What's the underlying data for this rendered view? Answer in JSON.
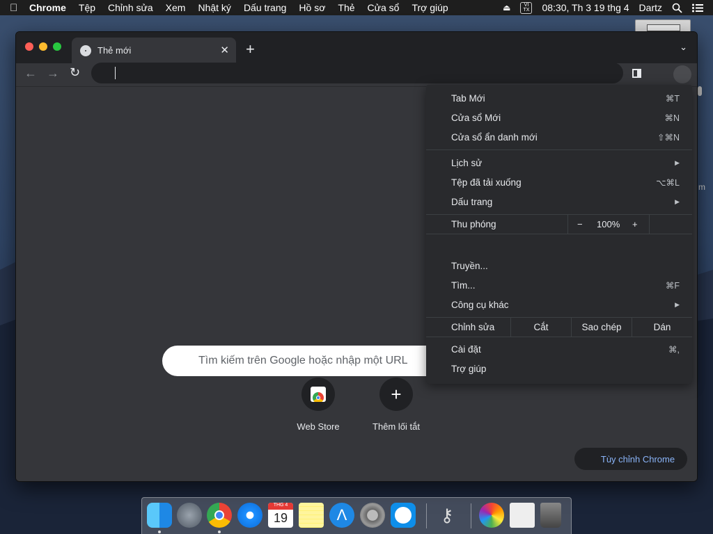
{
  "menubar": {
    "app": "Chrome",
    "items": [
      "Tệp",
      "Chỉnh sửa",
      "Xem",
      "Nhật ký",
      "Dấu trang",
      "Hồ sơ",
      "Thẻ",
      "Cửa sổ",
      "Trợ giúp"
    ],
    "vi_top": "VI",
    "vi_bottom": "TX",
    "clock": "08:30, Th 3 19 thg 4",
    "user": "Dartz"
  },
  "tab": {
    "title": "Thẻ mới"
  },
  "newtab": {
    "search_placeholder": "Tìm kiếm trên Google hoặc nhập một URL",
    "shortcuts": [
      {
        "label": "Web Store"
      },
      {
        "label": "Thêm lối tắt"
      }
    ],
    "customize": "Tùy chỉnh Chrome"
  },
  "menu": {
    "new_tab": "Tab Mới",
    "new_tab_sc": "⌘T",
    "new_window": "Cửa sổ Mới",
    "new_window_sc": "⌘N",
    "incognito": "Cửa sổ ẩn danh mới",
    "incognito_sc": "⇧⌘N",
    "history": "Lịch sử",
    "downloads": "Tệp đã tải xuống",
    "downloads_sc": "⌥⌘L",
    "bookmarks": "Dấu trang",
    "zoom": "Thu phóng",
    "zoom_minus": "−",
    "zoom_value": "100%",
    "zoom_plus": "+",
    "cast": "Truyền...",
    "find": "Tìm...",
    "find_sc": "⌘F",
    "more_tools": "Công cụ khác",
    "edit": "Chỉnh sửa",
    "cut": "Cắt",
    "copy": "Sao chép",
    "paste": "Dán",
    "settings": "Cài đặt",
    "settings_sc": "⌘,",
    "help": "Trợ giúp"
  },
  "dock": {
    "calendar_month": "THG 4",
    "calendar_day": "19"
  },
  "side_letter": "m"
}
